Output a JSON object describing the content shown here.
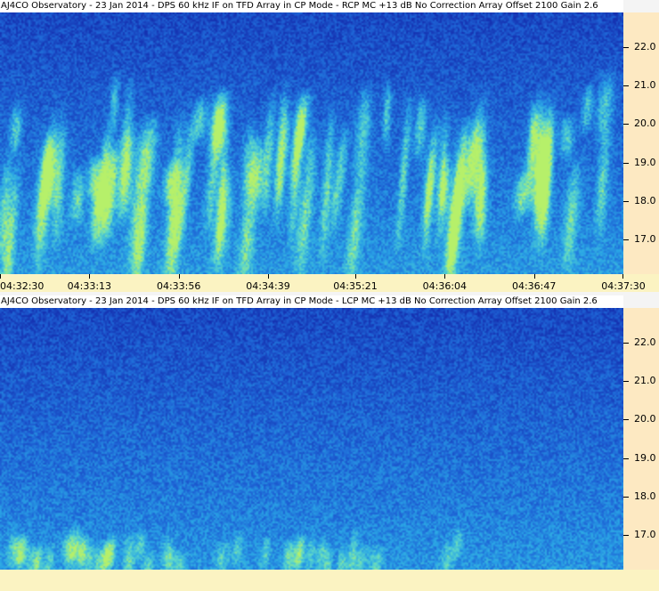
{
  "chart_data": [
    {
      "type": "heatmap",
      "title": "AJ4CO Observatory - 23 Jan 2014 - DPS 60 kHz IF on TFD Array in CP Mode - RCP  MC +13 dB  No Correction Array  Offset 2100   Gain 2.6",
      "polarization": "RCP",
      "xlabel": "",
      "ylabel": "",
      "x_ticks": [
        "04:32:30",
        "04:33:13",
        "04:33:56",
        "04:34:39",
        "04:35:21",
        "04:36:04",
        "04:36:47",
        "04:37:30"
      ],
      "y_ticks": [
        "22.0",
        "21.0",
        "20.0",
        "19.0",
        "18.0",
        "17.0"
      ],
      "xlim": [
        "04:32:30",
        "04:37:30"
      ],
      "ylim": [
        16.1,
        22.9
      ],
      "colors": [
        "#1530b0",
        "#1e64d6",
        "#2aa6e6",
        "#5fd9c8",
        "#b6f06a"
      ]
    },
    {
      "type": "heatmap",
      "title": "AJ4CO Observatory - 23 Jan 2014 - DPS 60 kHz IF on TFD Array in CP Mode - LCP  MC +13 dB  No Correction Array  Offset 2100   Gain 2.6",
      "polarization": "LCP",
      "xlabel": "",
      "ylabel": "",
      "x_ticks": [],
      "y_ticks": [
        "22.0",
        "21.0",
        "20.0",
        "19.0",
        "18.0",
        "17.0"
      ],
      "xlim": [
        "04:32:30",
        "04:37:30"
      ],
      "ylim": [
        16.1,
        22.9
      ],
      "colors": [
        "#1530b0",
        "#1e64d6",
        "#2aa6e6",
        "#5fd9c8",
        "#b6f06a"
      ]
    }
  ]
}
